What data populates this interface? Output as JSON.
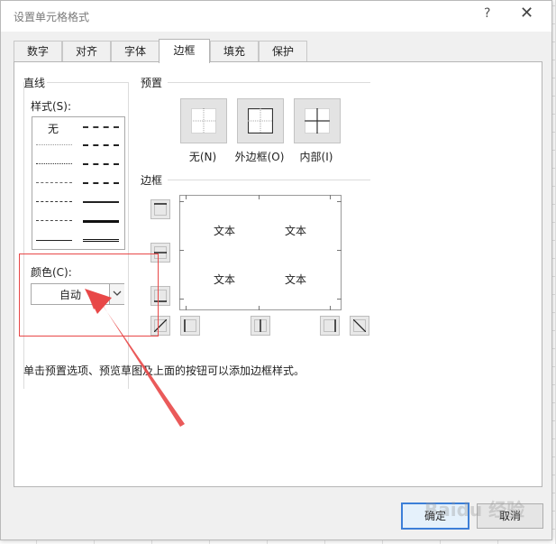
{
  "dialog": {
    "title": "设置单元格格式",
    "help_glyph": "?",
    "close_glyph": "✕"
  },
  "tabs": [
    {
      "label": "数字",
      "active": false
    },
    {
      "label": "对齐",
      "active": false
    },
    {
      "label": "字体",
      "active": false
    },
    {
      "label": "边框",
      "active": true
    },
    {
      "label": "填充",
      "active": false
    },
    {
      "label": "保护",
      "active": false
    }
  ],
  "line_group": {
    "label": "直线",
    "style_label": "样式(S):",
    "style_none": "无",
    "color_label": "颜色(C):",
    "color_value": "自动"
  },
  "presets": {
    "label": "预置",
    "items": [
      {
        "label": "无(N)"
      },
      {
        "label": "外边框(O)"
      },
      {
        "label": "内部(I)"
      }
    ]
  },
  "border_group": {
    "label": "边框",
    "preview_texts": [
      "文本",
      "文本",
      "文本",
      "文本"
    ]
  },
  "hint": "单击预置选项、预览草图及上面的按钮可以添加边框样式。",
  "buttons": {
    "ok": "确定",
    "cancel": "取消"
  },
  "watermark": "Baidu 经验",
  "colors": {
    "highlight": "#e84848",
    "ok_border": "#3c7fd8"
  }
}
